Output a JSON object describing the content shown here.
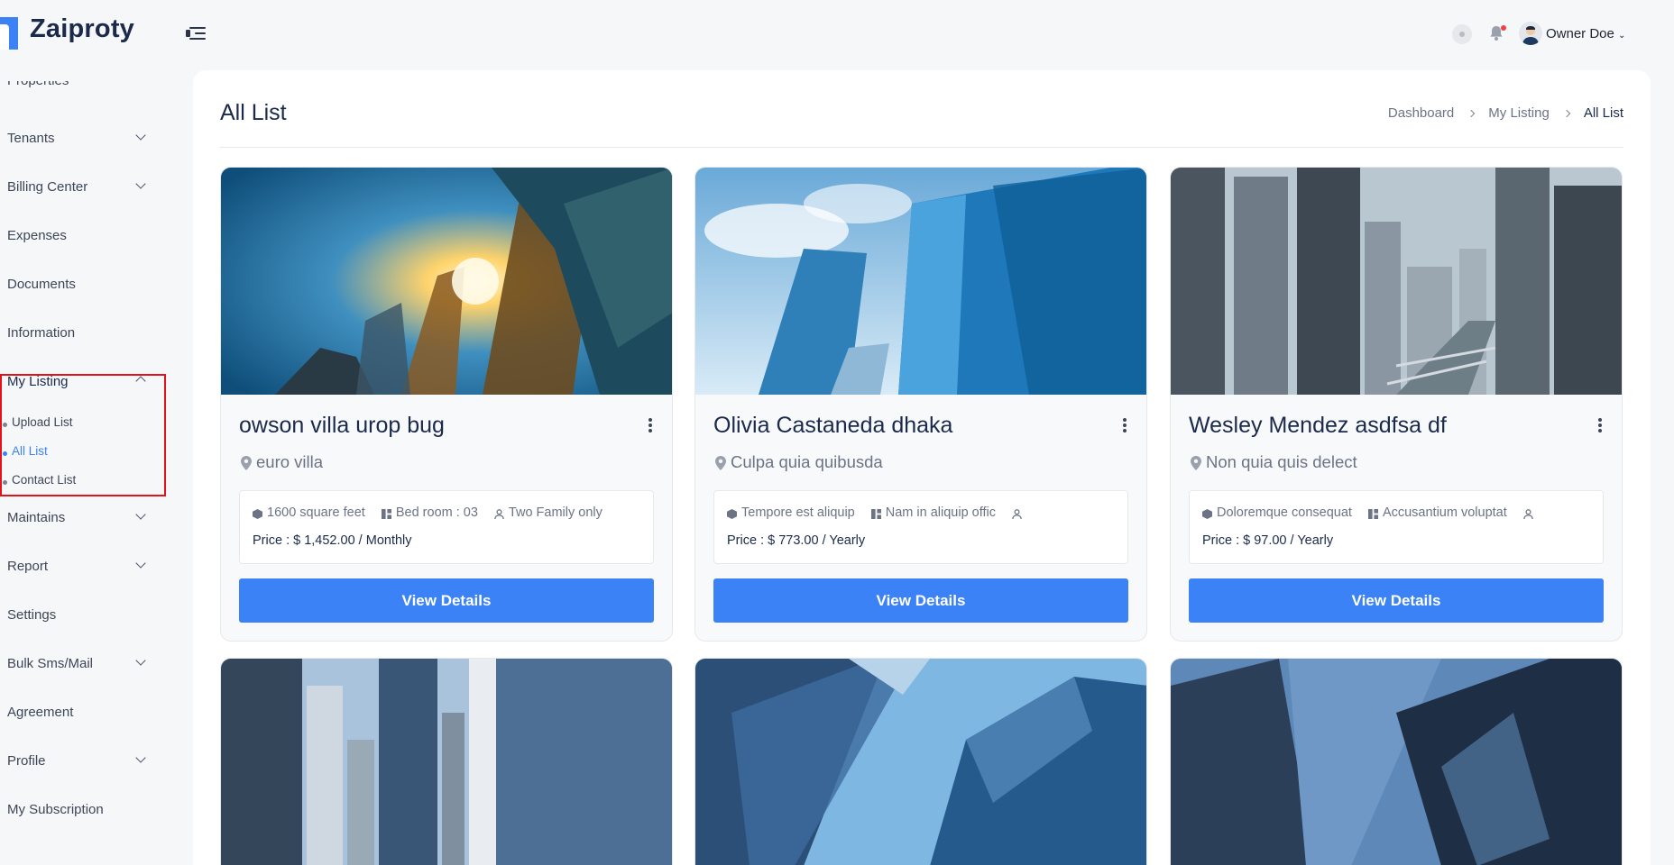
{
  "app": {
    "name": "Zaiproty"
  },
  "header": {
    "user_name": "Owner Doe"
  },
  "sidebar": {
    "items": [
      {
        "label": "Properties"
      },
      {
        "label": "Tenants"
      },
      {
        "label": "Billing Center"
      },
      {
        "label": "Expenses"
      },
      {
        "label": "Documents"
      },
      {
        "label": "Information"
      },
      {
        "label": "My Listing"
      },
      {
        "label": "Maintains"
      },
      {
        "label": "Report"
      },
      {
        "label": "Settings"
      },
      {
        "label": "Bulk Sms/Mail"
      },
      {
        "label": "Agreement"
      },
      {
        "label": "Profile"
      },
      {
        "label": "My Subscription"
      }
    ],
    "sub_items": [
      {
        "label": "Upload List"
      },
      {
        "label": "All List"
      },
      {
        "label": "Contact List"
      }
    ]
  },
  "page": {
    "title": "All List",
    "breadcrumb": [
      "Dashboard",
      "My Listing",
      "All List"
    ]
  },
  "listings": [
    {
      "title": "owson villa urop bug",
      "location": "euro villa",
      "area": "1600 square feet",
      "rooms": "Bed room : 03",
      "type": "Two Family only",
      "price": "Price : $ 1,452.00 / Monthly",
      "button": "View Details"
    },
    {
      "title": "Olivia Castaneda dhaka",
      "location": "Culpa quia quibusda",
      "area": "Tempore est aliquip",
      "rooms": "Nam in aliquip offic",
      "type": "",
      "price": "Price : $ 773.00 / Yearly",
      "button": "View Details"
    },
    {
      "title": "Wesley Mendez asdfsa df",
      "location": "Non quia quis delect",
      "area": "Doloremque consequat",
      "rooms": "Accusantium voluptat",
      "type": "",
      "price": "Price : $ 97.00 / Yearly",
      "button": "View Details"
    }
  ],
  "colors": {
    "accent": "#3b82f6",
    "highlight": "#e3131b"
  }
}
